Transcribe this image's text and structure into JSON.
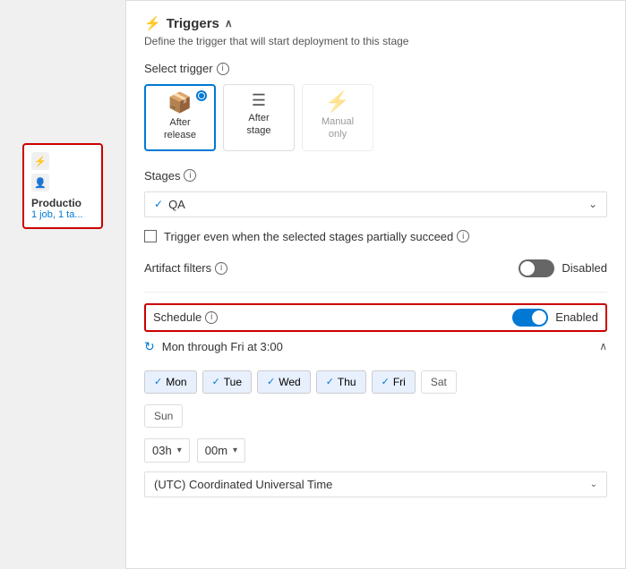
{
  "triggers": {
    "icon": "⚡",
    "title": "Triggers",
    "subtitle": "Define the trigger that will start deployment to this stage",
    "select_trigger_label": "Select trigger",
    "options": [
      {
        "id": "after-release",
        "icon": "📦",
        "line1": "After",
        "line2": "release",
        "selected": true
      },
      {
        "id": "after-stage",
        "icon": "☰",
        "line1": "After",
        "line2": "stage",
        "selected": false
      },
      {
        "id": "manual-only",
        "icon": "⚡",
        "line1": "Manual",
        "line2": "only",
        "selected": false,
        "disabled": true
      }
    ]
  },
  "stages": {
    "label": "Stages",
    "selected_value": "QA",
    "checkmark": "✓",
    "arrow": "⌄"
  },
  "partial_success": {
    "label": "Trigger even when the selected stages partially succeed"
  },
  "artifact_filters": {
    "label": "Artifact filters",
    "status": "Disabled",
    "toggle_state": "off"
  },
  "schedule": {
    "label": "Schedule",
    "enabled_label": "Enabled",
    "toggle_state": "on",
    "summary_text": "Mon through Fri at 3:00",
    "days": [
      {
        "label": "Mon",
        "active": true
      },
      {
        "label": "Tue",
        "active": true
      },
      {
        "label": "Wed",
        "active": true
      },
      {
        "label": "Thu",
        "active": true
      },
      {
        "label": "Fri",
        "active": true
      },
      {
        "label": "Sat",
        "active": false
      }
    ],
    "second_row_days": [
      {
        "label": "Sun",
        "active": false
      }
    ],
    "hour": "03h",
    "minute": "00m",
    "timezone": "(UTC) Coordinated Universal Time"
  },
  "stage_card": {
    "name": "Productio",
    "info": "1 job, 1 ta..."
  }
}
